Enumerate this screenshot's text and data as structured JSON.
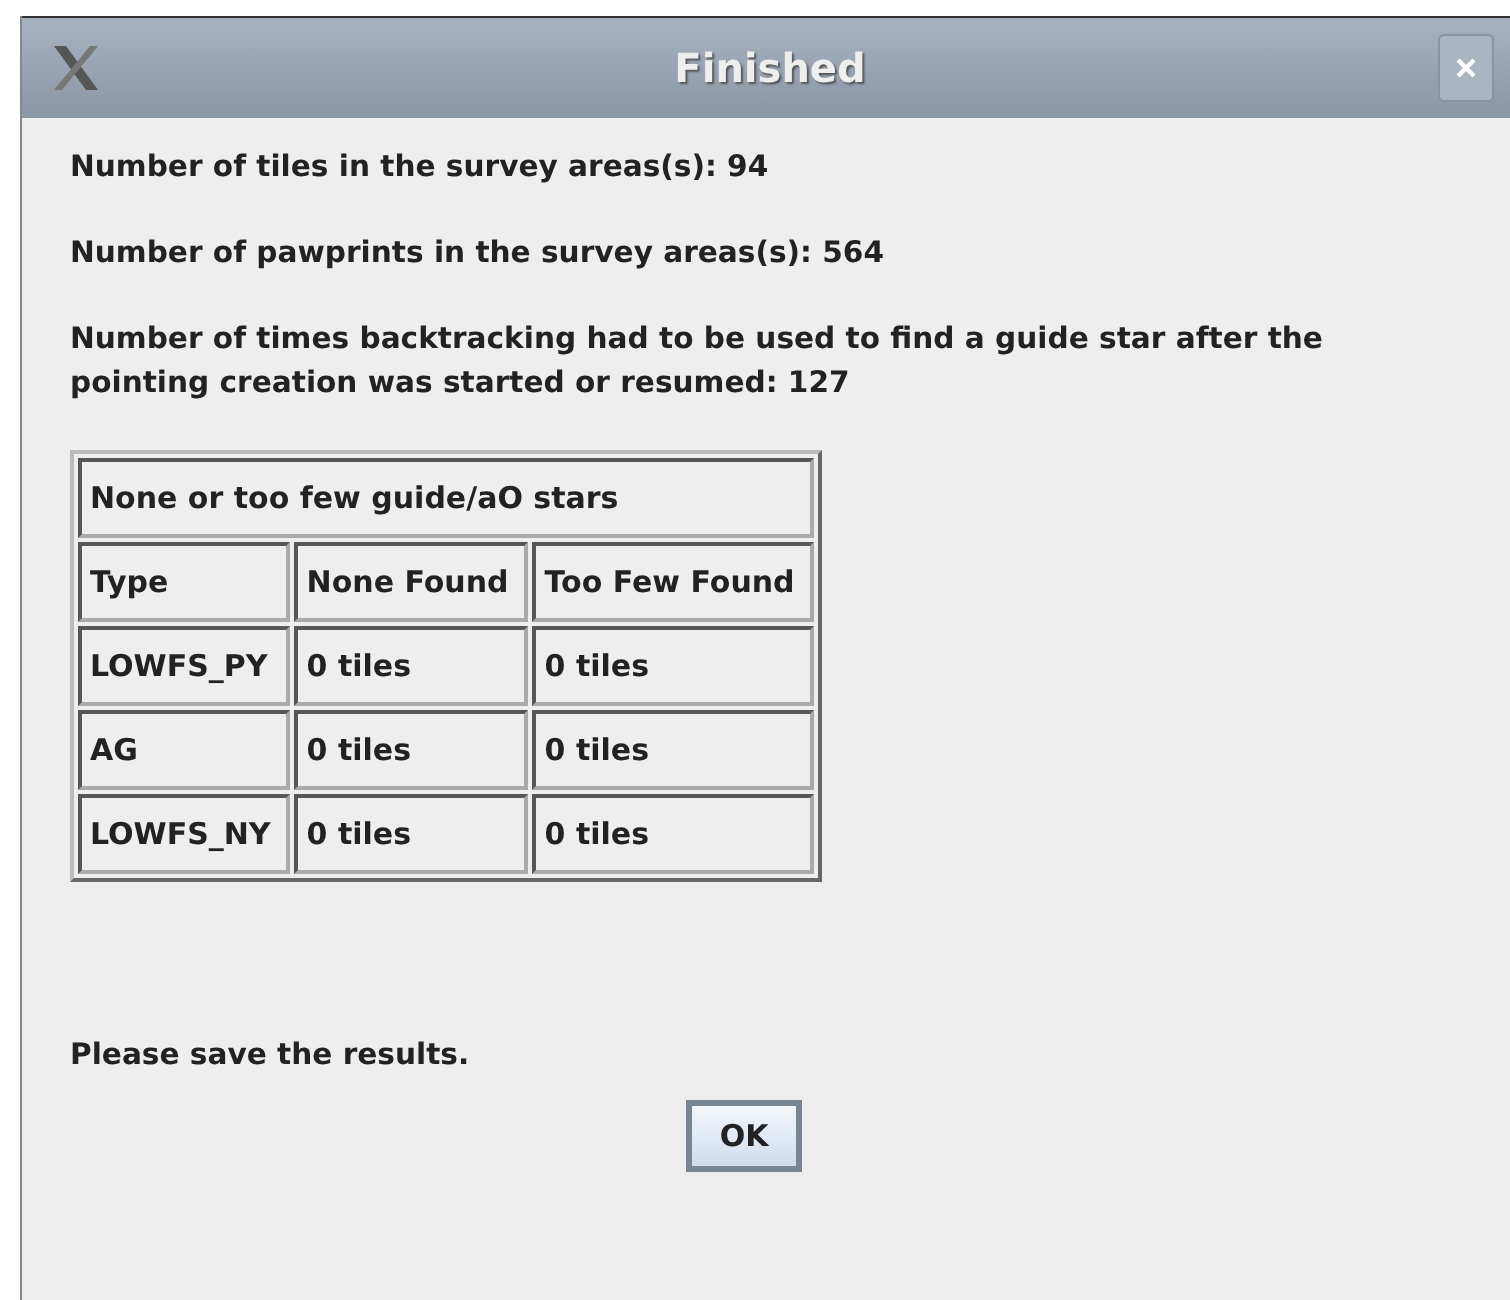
{
  "window": {
    "title": "Finished"
  },
  "messages": [
    "Number of tiles in the survey areas(s): 94",
    "Number of pawprints in the survey areas(s): 564",
    "Number of times backtracking had to be used to find a guide star after the pointing creation was started or resumed: 127"
  ],
  "table": {
    "caption": "None or too few guide/aO stars",
    "columns": [
      "Type",
      "None Found",
      "Too Few Found"
    ],
    "rows": [
      [
        "LOWFS_PY",
        "0 tiles",
        "0 tiles"
      ],
      [
        "AG",
        "0 tiles",
        "0 tiles"
      ],
      [
        "LOWFS_NY",
        "0 tiles",
        "0 tiles"
      ]
    ]
  },
  "footer": "Please save the results.",
  "buttons": [
    "OK"
  ]
}
